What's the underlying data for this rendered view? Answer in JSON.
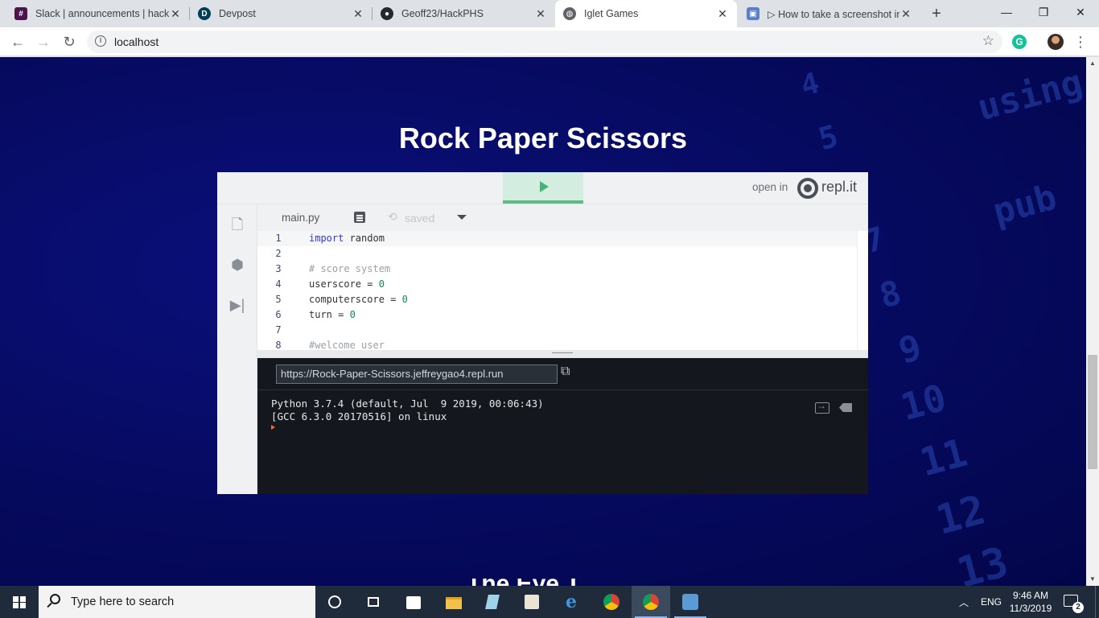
{
  "browser": {
    "tabs": [
      {
        "title": "Slack | announcements | hackP",
        "favicon": "slack-icon",
        "active": false
      },
      {
        "title": "Devpost",
        "favicon": "devpost-icon",
        "active": false
      },
      {
        "title": "Geoff23/HackPHS",
        "favicon": "github-icon",
        "active": false
      },
      {
        "title": "Iglet Games",
        "favicon": "globe-icon",
        "active": true
      },
      {
        "title": "▷ How to take a screenshot in",
        "favicon": "screenshot-icon",
        "active": false
      }
    ],
    "url": "localhost",
    "window_controls": {
      "minimize": "—",
      "maximize": "❐",
      "close": "✕"
    }
  },
  "page": {
    "title": "Rock Paper Scissors",
    "next_heading_partial": "The Eye T",
    "background_decor": [
      "4",
      "5",
      "7",
      "8",
      "9",
      "10",
      "11",
      "12",
      "13",
      "using",
      "pub"
    ]
  },
  "repl": {
    "open_in_label": "open in",
    "brand": "repl.it",
    "file_name": "main.py",
    "save_status": "saved",
    "code_lines": [
      {
        "n": "1",
        "tokens": [
          {
            "t": "import",
            "c": "kw"
          },
          {
            "t": " random",
            "c": ""
          }
        ]
      },
      {
        "n": "2",
        "tokens": []
      },
      {
        "n": "3",
        "tokens": [
          {
            "t": "# score system",
            "c": "cmt"
          }
        ]
      },
      {
        "n": "4",
        "tokens": [
          {
            "t": "userscore = ",
            "c": ""
          },
          {
            "t": "0",
            "c": "num"
          }
        ]
      },
      {
        "n": "5",
        "tokens": [
          {
            "t": "computerscore = ",
            "c": ""
          },
          {
            "t": "0",
            "c": "num"
          }
        ]
      },
      {
        "n": "6",
        "tokens": [
          {
            "t": "turn = ",
            "c": ""
          },
          {
            "t": "0",
            "c": "num"
          }
        ]
      },
      {
        "n": "7",
        "tokens": []
      },
      {
        "n": "8",
        "tokens": [
          {
            "t": "#welcome user",
            "c": "cmt"
          }
        ]
      }
    ],
    "run_url": "https://Rock-Paper-Scissors.jeffreygao4.repl.run",
    "console_output": "Python 3.7.4 (default, Jul  9 2019, 00:06:43)\n[GCC 6.3.0 20170516] on linux",
    "colors": {
      "run_green": "#48b27a",
      "console_bg": "#14181e",
      "prompt": "#f26b2b"
    }
  },
  "taskbar": {
    "search_placeholder": "Type here to search",
    "apps": [
      "task-view-icon",
      "store-icon",
      "file-explorer-icon",
      "notepad-icon",
      "photos-icon",
      "edge-icon",
      "chrome-icon",
      "chrome-profile-icon",
      "network-app-icon"
    ],
    "language": "ENG",
    "time": "9:46 AM",
    "date": "11/3/2019",
    "notification_count": "2"
  }
}
